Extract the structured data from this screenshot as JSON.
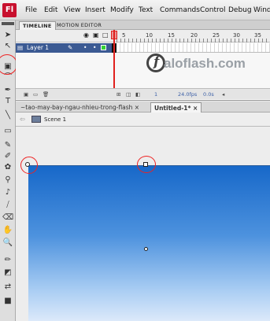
{
  "app": {
    "icon_text": "Fl"
  },
  "menu": [
    "File",
    "Edit",
    "View",
    "Insert",
    "Modify",
    "Text",
    "Commands",
    "Control",
    "Debug",
    "Window"
  ],
  "tools": [
    {
      "name": "selection-arrow",
      "glyph": "➤"
    },
    {
      "name": "subselection",
      "glyph": "↖"
    },
    {
      "name": "gradient-transform",
      "glyph": "▣"
    },
    {
      "name": "lasso",
      "glyph": "⌒"
    },
    {
      "name": "pen",
      "glyph": "✒"
    },
    {
      "name": "text",
      "glyph": "T"
    },
    {
      "name": "line",
      "glyph": "╲"
    },
    {
      "name": "rectangle",
      "glyph": "▭"
    },
    {
      "name": "pencil",
      "glyph": "✎"
    },
    {
      "name": "brush",
      "glyph": "✐"
    },
    {
      "name": "deco",
      "glyph": "✿"
    },
    {
      "name": "bone",
      "glyph": "⚲"
    },
    {
      "name": "paint-bucket",
      "glyph": "♪"
    },
    {
      "name": "eyedropper",
      "glyph": "⧸"
    },
    {
      "name": "eraser",
      "glyph": "⌫"
    },
    {
      "name": "hand",
      "glyph": "✋"
    },
    {
      "name": "zoom",
      "glyph": "🔍"
    },
    {
      "name": "stroke-color",
      "glyph": "✏"
    },
    {
      "name": "fill-color",
      "glyph": "◩"
    },
    {
      "name": "swap-colors",
      "glyph": "⇄"
    },
    {
      "name": "default-colors",
      "glyph": "■"
    }
  ],
  "timeline_tabs": [
    "TIMELINE",
    "MOTION EDITOR"
  ],
  "timeline": {
    "ruler_numbers": [
      "5",
      "10",
      "15",
      "20",
      "25",
      "30",
      "35"
    ],
    "layer_name": "Layer 1",
    "footer": {
      "frame": "1",
      "fps": "24.0fps",
      "time": "0.0s"
    }
  },
  "watermark": {
    "text": "aloflash.com"
  },
  "doc_tabs": [
    {
      "label": "~tao-may-bay-ngau-nhieu-trong-flash ×",
      "active": false
    },
    {
      "label": "Untitled-1* ×",
      "active": true
    }
  ],
  "editbar": {
    "scene": "Scene 1"
  },
  "stage": {
    "gradient_top": "#1768c9",
    "gradient_bottom": "#dce9fa"
  }
}
